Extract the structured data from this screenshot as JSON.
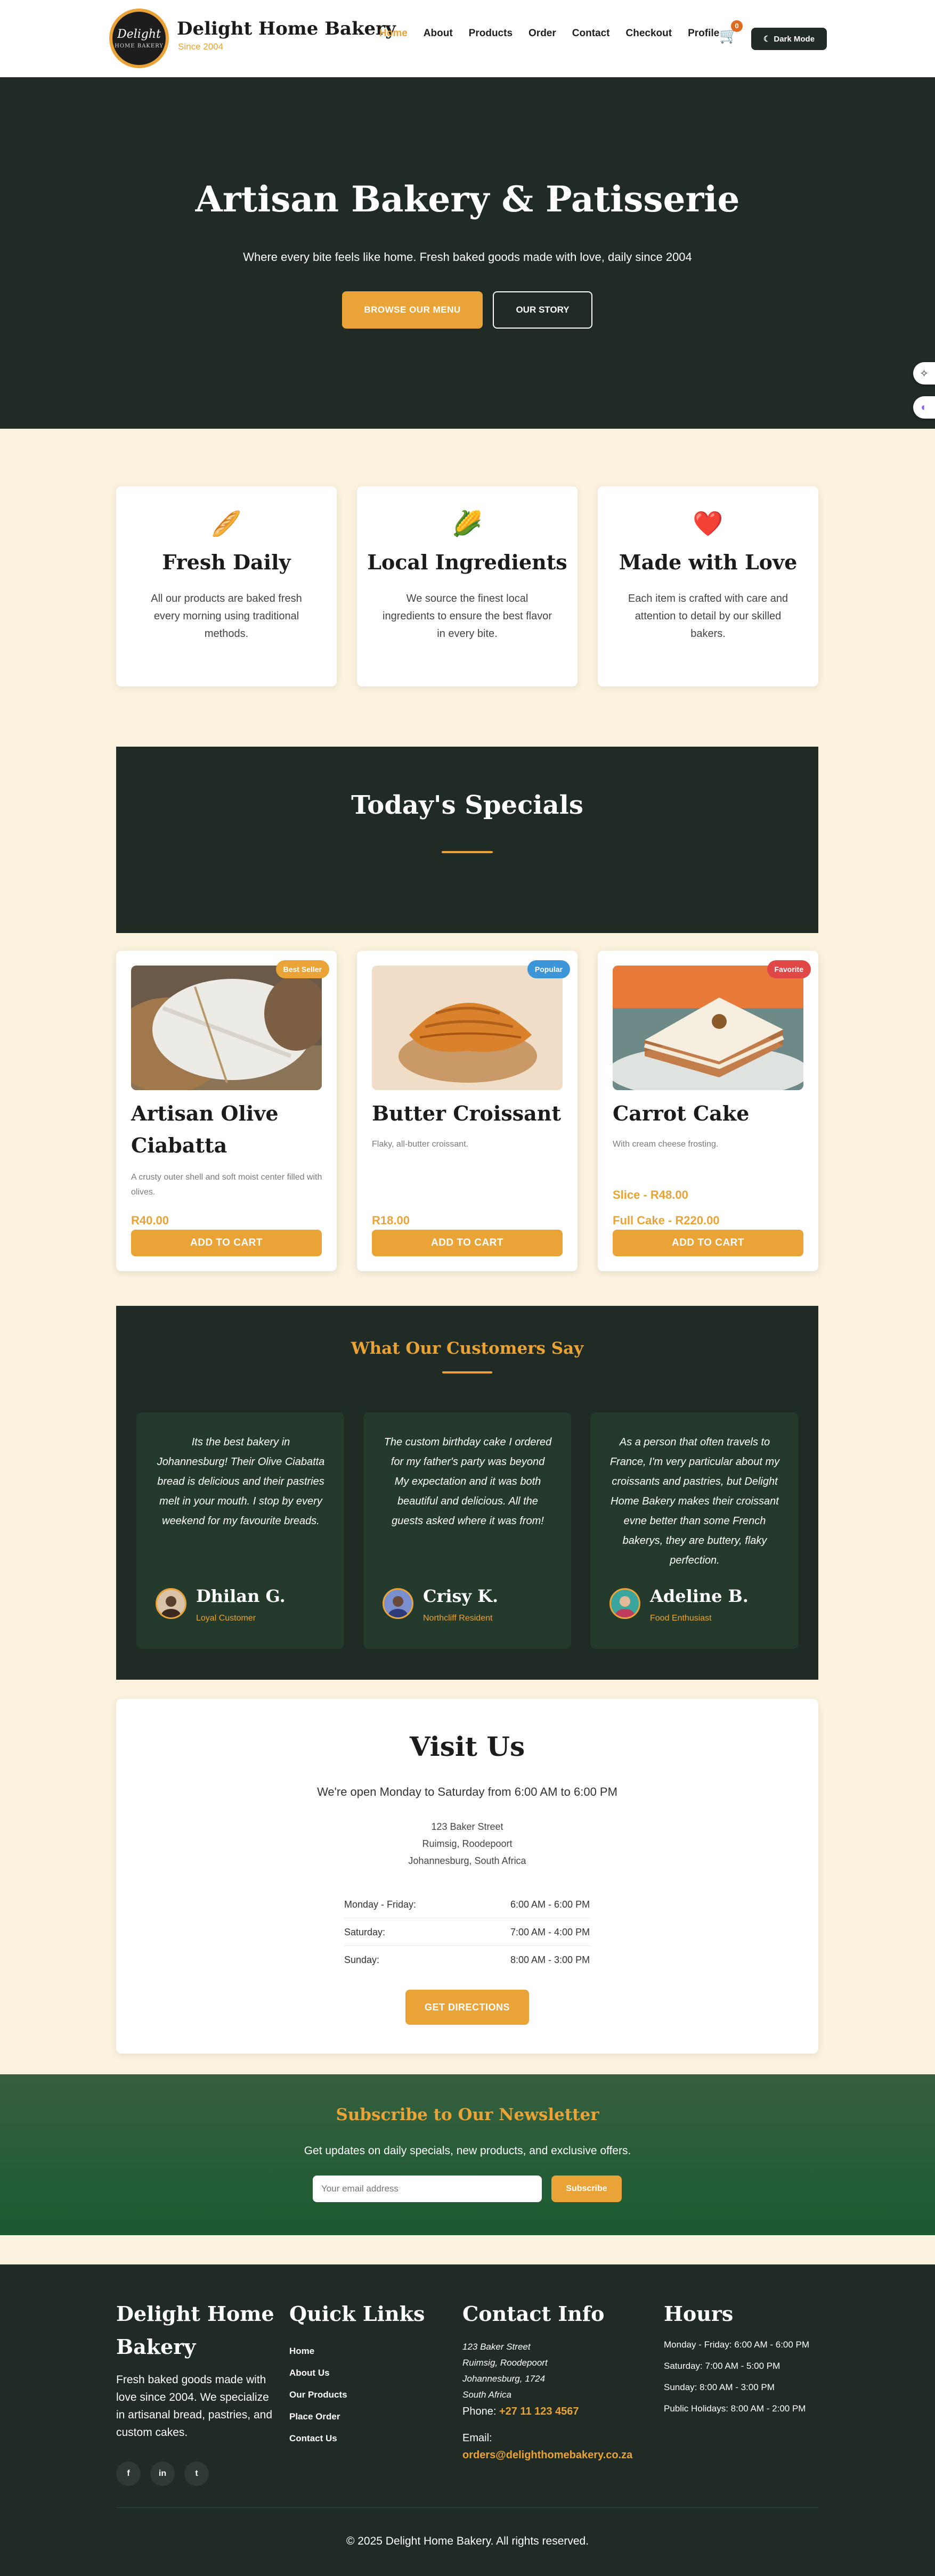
{
  "header": {
    "logo_text": "Delight",
    "logo_sub": "HOME BAKERY",
    "brand": "Delight Home Bakery",
    "since": "Since 2004",
    "nav": [
      "Home",
      "About",
      "Products",
      "Order",
      "Contact",
      "Checkout",
      "Profile"
    ],
    "active_nav": "Home",
    "cart_count": "0",
    "dark_mode_label": "Dark Mode",
    "dark_mode_icon": "moon-icon"
  },
  "hero": {
    "title": "Artisan Bakery & Patisserie",
    "subtitle": "Where every bite feels like home. Fresh baked goods made with love, daily since 2004",
    "primary_button": "BROWSE OUR MENU",
    "secondary_button": "OUR STORY"
  },
  "features": [
    {
      "icon": "bread-icon",
      "glyph": "🥖",
      "title": "Fresh Daily",
      "text": "All our products are baked fresh every morning using traditional methods."
    },
    {
      "icon": "corn-icon",
      "glyph": "🌽",
      "title": "Local Ingredients",
      "text": "We source the finest local ingredients to ensure the best flavor in every bite."
    },
    {
      "icon": "heart-icon",
      "glyph": "❤️",
      "title": "Made with Love",
      "text": "Each item is crafted with care and attention to detail by our skilled bakers."
    }
  ],
  "specials": {
    "title": "Today's Specials",
    "add_label": "ADD TO CART",
    "products": [
      {
        "name": "Artisan Olive Ciabatta",
        "badge": "Best Seller",
        "badge_color": "#e9a336",
        "desc": "A crusty outer shell and soft moist center filled with olives.",
        "prices": [
          "R40.00"
        ]
      },
      {
        "name": "Butter Croissant",
        "badge": "Popular",
        "badge_color": "#3b95d6",
        "desc": "Flaky, all-butter croissant.",
        "prices": [
          "R18.00"
        ]
      },
      {
        "name": "Carrot Cake",
        "badge": "Favorite",
        "badge_color": "#e04848",
        "desc": "With cream cheese frosting.",
        "prices": [
          "Slice - R48.00",
          "Full Cake - R220.00"
        ]
      }
    ]
  },
  "testimonials": {
    "title": "What Our Customers Say",
    "items": [
      {
        "quote": "Its the best bakery in Johannesburg! Their Olive Ciabatta bread is delicious and their pastries melt in your mouth. I stop by every weekend for my favourite breads.",
        "name": "Dhilan G.",
        "role": "Loyal Customer"
      },
      {
        "quote": "The custom birthday cake I ordered for my father's party was beyond My expectation and it was both beautiful and delicious. All the guests asked where it was from!",
        "name": "Crisy K.",
        "role": "Northcliff Resident"
      },
      {
        "quote": "As a person that often travels to France, I'm very particular about my croissants and pastries, but Delight Home Bakery makes their croissant evne better than some French bakerys, they are buttery, flaky perfection.",
        "name": "Adeline B.",
        "role": "Food Enthusiast"
      }
    ]
  },
  "visit": {
    "title": "Visit Us",
    "open": "We're open Monday to Saturday from 6:00 AM to 6:00 PM",
    "address": [
      "123 Baker Street",
      "Ruimsig, Roodepoort",
      "Johannesburg, South Africa"
    ],
    "hours": [
      {
        "day": "Monday - Friday:",
        "time": "6:00 AM - 6:00 PM"
      },
      {
        "day": "Saturday:",
        "time": "7:00 AM - 4:00 PM"
      },
      {
        "day": "Sunday:",
        "time": "8:00 AM - 3:00 PM"
      }
    ],
    "button": "GET DIRECTIONS"
  },
  "newsletter": {
    "title": "Subscribe to Our Newsletter",
    "text": "Get updates on daily specials, new products, and exclusive offers.",
    "placeholder": "Your email address",
    "button": "Subscribe"
  },
  "footer": {
    "brand": "Delight Home Bakery",
    "about": "Fresh baked goods made with love since 2004. We specialize in artisanal bread, pastries, and custom cakes.",
    "social": [
      "f",
      "in",
      "t"
    ],
    "links_title": "Quick Links",
    "links": [
      "Home",
      "About Us",
      "Our Products",
      "Place Order",
      "Contact Us"
    ],
    "contact_title": "Contact Info",
    "contact_address": [
      "123 Baker Street",
      "Ruimsig, Roodepoort",
      "Johannesburg, 1724",
      "South Africa"
    ],
    "phone_label": "Phone:",
    "phone": "+27 11 123 4567",
    "email_label": "Email:",
    "email": "orders@delighthomebakery.co.za",
    "hours_title": "Hours",
    "hours": [
      "Monday - Friday: 6:00 AM - 6:00 PM",
      "Saturday: 7:00 AM - 5:00 PM",
      "Sunday: 8:00 AM - 3:00 PM",
      "Public Holidays: 8:00 AM - 2:00 PM"
    ],
    "copyright": "© 2025 Delight Home Bakery. All rights reserved."
  },
  "colors": {
    "accent": "#e9a336",
    "dark": "#1f2b24",
    "cream": "#fbf2de"
  }
}
